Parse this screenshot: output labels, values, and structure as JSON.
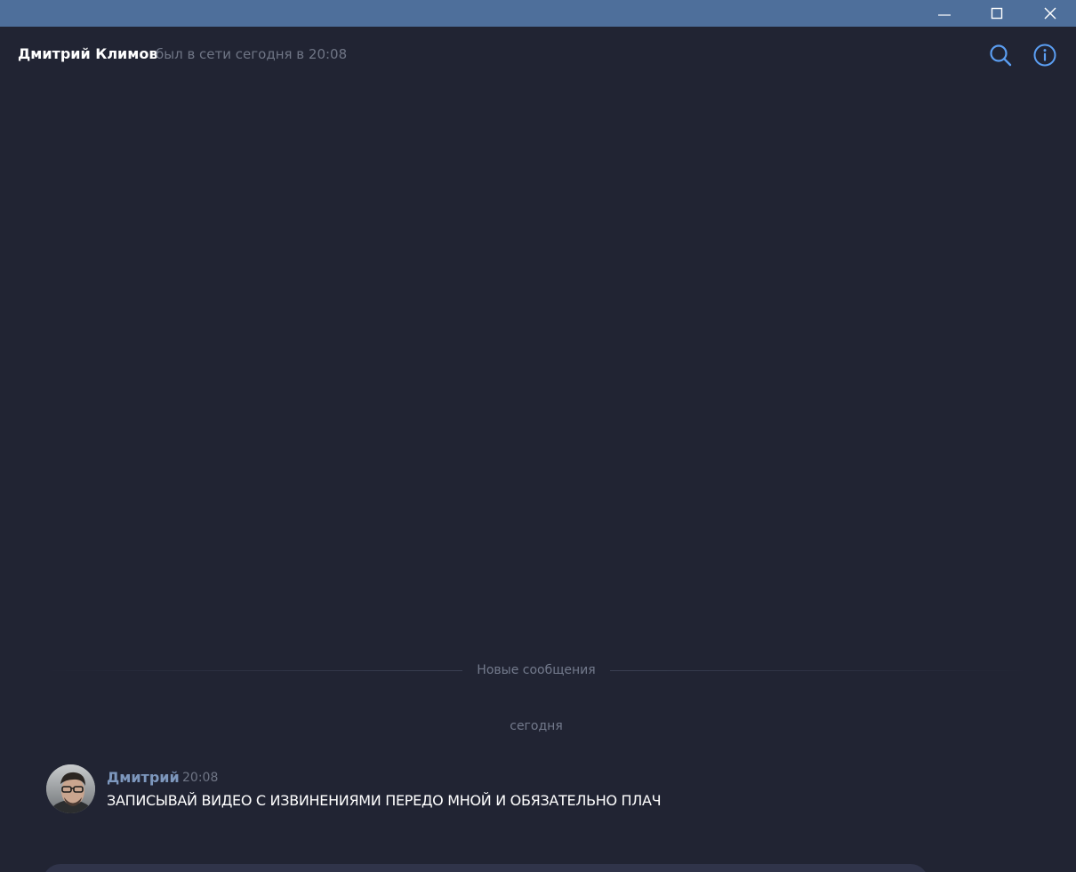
{
  "window": {
    "controls": {
      "minimize_icon": "minimize-icon",
      "maximize_icon": "maximize-icon",
      "close_icon": "close-icon"
    },
    "titlebar_color": "#4e6f9b"
  },
  "header": {
    "contact_name": "Дмитрий Климов",
    "status": "был в сети сегодня в 20:08",
    "search_icon": "search-icon",
    "info_icon": "info-icon",
    "accent_color": "#5b9ef2"
  },
  "chat": {
    "new_messages_label": "Новые сообщения",
    "date_label": "сегодня",
    "messages": [
      {
        "author": "Дмитрий",
        "time": "20:08",
        "text": "ЗАПИСЫВАЙ ВИДЕО С ИЗВИНЕНИЯМИ ПЕРЕДО МНОЙ И ОБЯЗАТЕЛЬНО ПЛАЧ"
      }
    ]
  },
  "colors": {
    "background": "#212433",
    "author_name": "#7d97bd",
    "muted_text": "#6f7585"
  }
}
